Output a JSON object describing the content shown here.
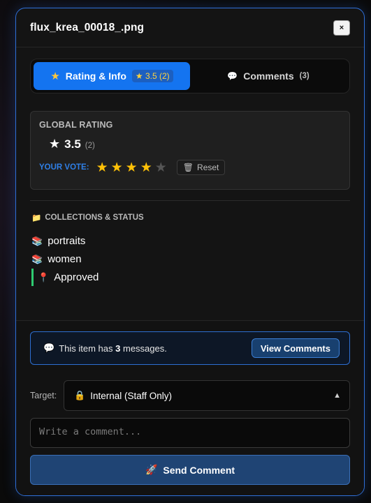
{
  "modal": {
    "title": "flux_krea_00018_.png",
    "close_label": "×"
  },
  "tabs": [
    {
      "icon": "star-icon",
      "label": "Rating & Info",
      "badge": "★ 3.5 (2)",
      "active": true
    },
    {
      "icon": "speech-bubble-icon",
      "label": "Comments",
      "count": "(3)",
      "active": false
    }
  ],
  "rating": {
    "section_label": "GLOBAL RATING",
    "global_star": "★",
    "global_value": "3.5",
    "global_count": "(2)",
    "vote_label": "YOUR VOTE:",
    "your_vote": 4,
    "max_stars": 5,
    "reset_label": "Reset"
  },
  "collections": {
    "title": "COLLECTIONS & STATUS",
    "items": [
      {
        "icon": "books-icon",
        "label": "portraits"
      },
      {
        "icon": "books-icon",
        "label": "women"
      }
    ],
    "status": {
      "icon": "pin-icon",
      "label": "Approved",
      "color": "#2ecc71"
    }
  },
  "messages": {
    "prefix": "This item has",
    "count": "3",
    "suffix": "messages.",
    "view_label": "View Comments"
  },
  "target": {
    "label": "Target:",
    "value": "Internal (Staff Only)"
  },
  "comment": {
    "placeholder": "Write a comment..."
  },
  "send": {
    "label": "Send Comment"
  },
  "colors": {
    "accent": "#1474f0",
    "border": "#2f6fd8",
    "star": "#ffc107",
    "status": "#2ecc71"
  }
}
